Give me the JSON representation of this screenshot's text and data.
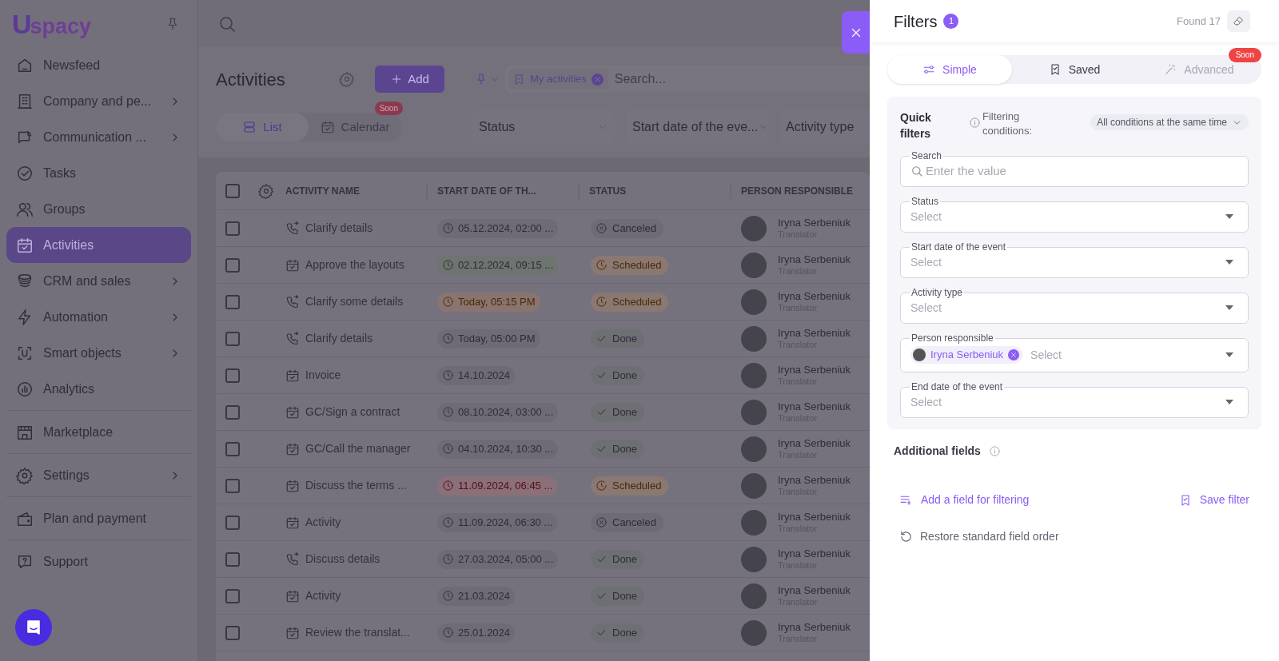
{
  "sidebar": {
    "logo": {
      "mark": "U",
      "text": "spacy"
    },
    "sections": [
      {
        "items": [
          {
            "label": "Newsfeed",
            "has_submenu": false,
            "selected": false
          },
          {
            "label": "Company and pe...",
            "has_submenu": true,
            "selected": false
          },
          {
            "label": "Communication ...",
            "has_submenu": true,
            "selected": false
          },
          {
            "label": "Tasks",
            "has_submenu": false,
            "selected": false
          },
          {
            "label": "Groups",
            "has_submenu": false,
            "selected": false
          },
          {
            "label": "Activities",
            "has_submenu": false,
            "selected": true
          },
          {
            "label": "CRM and sales",
            "has_submenu": true,
            "selected": false
          },
          {
            "label": "Automation",
            "has_submenu": true,
            "selected": false
          },
          {
            "label": "Smart objects",
            "has_submenu": true,
            "selected": false
          },
          {
            "label": "Analytics",
            "has_submenu": false,
            "selected": false
          }
        ]
      },
      {
        "items": [
          {
            "label": "Marketplace",
            "has_submenu": false,
            "selected": false
          }
        ]
      },
      {
        "items": [
          {
            "label": "Settings",
            "has_submenu": true,
            "selected": false
          }
        ]
      },
      {
        "items": [
          {
            "label": "Plan and payment",
            "has_submenu": false,
            "selected": false
          }
        ]
      },
      {
        "items": [
          {
            "label": "Support",
            "has_submenu": false,
            "selected": false
          }
        ]
      }
    ]
  },
  "page": {
    "title": "Activities",
    "add_button": "Add",
    "view_tabs": [
      {
        "label": "List",
        "selected": true
      },
      {
        "label": "Calendar",
        "selected": false,
        "badge": "Soon"
      }
    ],
    "saved_filter_chip": "My activities",
    "search": {
      "placeholder": "Search..."
    },
    "filter_dropdowns": [
      "Status",
      "Start date of the eve...",
      "Activity type"
    ]
  },
  "table": {
    "select_all_checked": false,
    "columns": [
      "ACTIVITY NAME",
      "START DATE OF TH...",
      "STATUS",
      "PERSON RESPONSIBLE"
    ],
    "rows": [
      {
        "checked": false,
        "kind": "call",
        "name": "Clarify details",
        "date": {
          "text": "05.12.2024, 02:00 ...",
          "kind": "normal"
        },
        "status": {
          "text": "Canceled",
          "kind": "canceled"
        },
        "person": "Iryna Serbeniuk",
        "role": "Translator"
      },
      {
        "checked": false,
        "kind": "meeting",
        "name": "Approve the layouts",
        "date": {
          "text": "02.12.2024, 09:15 ...",
          "kind": "upcoming"
        },
        "status": {
          "text": "Scheduled",
          "kind": "scheduled"
        },
        "person": "Iryna Serbeniuk",
        "role": "Translator"
      },
      {
        "checked": false,
        "kind": "call",
        "name": "Clarify some details",
        "date": {
          "text": "Today, 05:15 PM",
          "kind": "today"
        },
        "status": {
          "text": "Scheduled",
          "kind": "scheduled"
        },
        "person": "Iryna Serbeniuk",
        "role": "Translator"
      },
      {
        "checked": false,
        "kind": "call",
        "name": "Clarify details",
        "date": {
          "text": "Today, 05:00 PM",
          "kind": "normal"
        },
        "status": {
          "text": "Done",
          "kind": "done"
        },
        "person": "Iryna Serbeniuk",
        "role": "Translator"
      },
      {
        "checked": false,
        "kind": "meeting",
        "name": "Invoice",
        "date": {
          "text": "14.10.2024",
          "kind": "normal"
        },
        "status": {
          "text": "Done",
          "kind": "done"
        },
        "person": "Iryna Serbeniuk",
        "role": "Translator"
      },
      {
        "checked": false,
        "kind": "meeting",
        "name": "GC/Sign a contract",
        "date": {
          "text": "08.10.2024, 03:00 ...",
          "kind": "normal"
        },
        "status": {
          "text": "Done",
          "kind": "done"
        },
        "person": "Iryna Serbeniuk",
        "role": "Translator"
      },
      {
        "checked": false,
        "kind": "meeting",
        "name": "GC/Call the manager",
        "date": {
          "text": "04.10.2024, 10:30 ...",
          "kind": "normal"
        },
        "status": {
          "text": "Done",
          "kind": "done"
        },
        "person": "Iryna Serbeniuk",
        "role": "Translator"
      },
      {
        "checked": false,
        "kind": "meeting",
        "name": "Discuss the terms ...",
        "date": {
          "text": "11.09.2024, 06:45 ...",
          "kind": "overdue"
        },
        "status": {
          "text": "Scheduled",
          "kind": "scheduled"
        },
        "person": "Iryna Serbeniuk",
        "role": "Translator"
      },
      {
        "checked": false,
        "kind": "meeting",
        "name": "Activity",
        "date": {
          "text": "11.09.2024, 06:30 ...",
          "kind": "normal"
        },
        "status": {
          "text": "Canceled",
          "kind": "canceled"
        },
        "person": "Iryna Serbeniuk",
        "role": "Translator"
      },
      {
        "checked": false,
        "kind": "call",
        "name": "Discuss details",
        "date": {
          "text": "27.03.2024, 05:00 ...",
          "kind": "normal"
        },
        "status": {
          "text": "Done",
          "kind": "done"
        },
        "person": "Iryna Serbeniuk",
        "role": "Translator"
      },
      {
        "checked": false,
        "kind": "meeting",
        "name": "Activity",
        "date": {
          "text": "21.03.2024",
          "kind": "normal"
        },
        "status": {
          "text": "Done",
          "kind": "done"
        },
        "person": "Iryna Serbeniuk",
        "role": "Translator"
      },
      {
        "checked": false,
        "kind": "meeting",
        "name": "Review the translat...",
        "date": {
          "text": "25.01.2024",
          "kind": "normal"
        },
        "status": {
          "text": "Done",
          "kind": "done"
        },
        "person": "Iryna Serbeniuk",
        "role": "Translator"
      }
    ]
  },
  "filters_panel": {
    "title": "Filters",
    "count": "1",
    "found": "Found 17",
    "tabs": [
      {
        "label": "Simple",
        "selected": true,
        "disabled": false
      },
      {
        "label": "Saved",
        "selected": false,
        "disabled": false
      },
      {
        "label": "Advanced",
        "selected": false,
        "disabled": true,
        "badge": "Soon"
      }
    ],
    "quick_filters": {
      "title": "Quick filters",
      "conditions_label": "Filtering conditions:",
      "conditions_value": "All conditions at the same time",
      "fields": [
        {
          "kind": "search",
          "label": "Search",
          "placeholder": "Enter the value"
        },
        {
          "kind": "select",
          "label": "Status",
          "placeholder": "Select"
        },
        {
          "kind": "select",
          "label": "Start date of the event",
          "placeholder": "Select"
        },
        {
          "kind": "select",
          "label": "Activity type",
          "placeholder": "Select"
        },
        {
          "kind": "select",
          "label": "Person responsible",
          "placeholder": "Select",
          "chips": [
            "Iryna Serbeniuk"
          ]
        },
        {
          "kind": "select",
          "label": "End date of the event",
          "placeholder": "Select"
        }
      ]
    },
    "additional_fields": "Additional fields",
    "add_field": "Add a field for filtering",
    "save_filter": "Save filter",
    "restore_order": "Restore standard field order"
  }
}
